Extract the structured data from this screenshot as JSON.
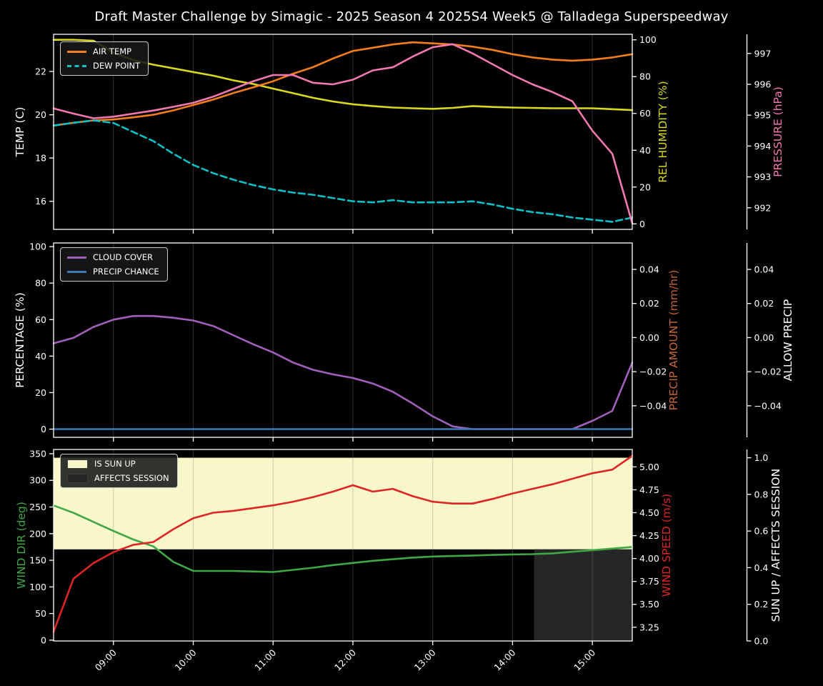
{
  "title": "Draft Master Challenge by Simagic - 2025 Season 4 2025S4 Week5 @ Talladega Superspeedway",
  "style": {
    "background": "#000000",
    "foreground": "#ffffff",
    "grid_color": "rgba(125,125,125,0.38)"
  },
  "xlim": [
    8.25,
    15.5
  ],
  "x_hours": [
    8.25,
    8.5,
    8.75,
    9.0,
    9.25,
    9.5,
    9.75,
    10.0,
    10.25,
    10.5,
    10.75,
    11.0,
    11.25,
    11.5,
    11.75,
    12.0,
    12.25,
    12.5,
    12.75,
    13.0,
    13.25,
    13.5,
    13.75,
    14.0,
    14.25,
    14.5,
    14.75,
    15.0,
    15.25,
    15.5
  ],
  "x_ticks": {
    "hours": [
      9,
      10,
      11,
      12,
      13,
      14,
      15
    ],
    "labels": [
      "09:00",
      "10:00",
      "11:00",
      "12:00",
      "13:00",
      "14:00",
      "15:00"
    ]
  },
  "chart_data": [
    {
      "type": "line",
      "axes": {
        "left": {
          "label": "TEMP (C)",
          "color": "#ffffff",
          "lim": [
            14.7,
            23.72
          ],
          "ticks": [
            16,
            18,
            20,
            22
          ],
          "tick_labels": [
            "16",
            "18",
            "20",
            "22"
          ]
        },
        "right1": {
          "label": "REL HUMIDITY (%)",
          "color": "#d9d91f",
          "lim": [
            -3,
            103
          ],
          "ticks": [
            0,
            20,
            40,
            60,
            80,
            100
          ],
          "tick_labels": [
            "0",
            "20",
            "40",
            "60",
            "80",
            "100"
          ]
        },
        "right2": {
          "label": "PRESSURE (hPa)",
          "color": "#f278b0",
          "lim": [
            991.3,
            997.62
          ],
          "ticks": [
            992,
            993,
            994,
            995,
            996,
            997
          ],
          "tick_labels": [
            "992",
            "993",
            "994",
            "995",
            "996",
            "997"
          ]
        }
      },
      "series": [
        {
          "name": "REL HUMIDITY",
          "axis": "right1",
          "color": "#d9d91f",
          "style": "solid",
          "values": [
            100,
            100,
            99.5,
            93,
            89,
            86.5,
            84.5,
            82.5,
            80.5,
            78,
            76,
            73.5,
            71,
            68.5,
            66.5,
            65,
            64,
            63.2,
            62.8,
            62.5,
            63,
            64,
            63.5,
            63.2,
            63,
            62.8,
            62.8,
            62.8,
            62.3,
            61.8
          ]
        },
        {
          "name": "AIR TEMP",
          "axis": "left",
          "color": "#f57d1c",
          "style": "solid",
          "values": [
            19.5,
            19.63,
            19.74,
            19.78,
            19.88,
            20.0,
            20.2,
            20.45,
            20.7,
            21.0,
            21.27,
            21.55,
            21.9,
            22.2,
            22.6,
            22.95,
            23.1,
            23.25,
            23.35,
            23.3,
            23.25,
            23.15,
            23.0,
            22.8,
            22.65,
            22.55,
            22.5,
            22.55,
            22.65,
            22.8
          ]
        },
        {
          "name": "DEW POINT",
          "axis": "left",
          "color": "#0cc0c6",
          "style": "dashed",
          "values": [
            19.5,
            19.63,
            19.74,
            19.62,
            19.2,
            18.78,
            18.2,
            17.68,
            17.3,
            17.0,
            16.75,
            16.55,
            16.4,
            16.3,
            16.15,
            16.0,
            15.95,
            16.05,
            15.95,
            15.95,
            15.95,
            16.0,
            15.85,
            15.65,
            15.5,
            15.4,
            15.25,
            15.15,
            15.05,
            15.25
          ]
        },
        {
          "name": "PRESSURE",
          "axis": "right2",
          "color": "#f278b0",
          "style": "solid",
          "values": [
            995.22,
            995.05,
            994.9,
            994.95,
            995.05,
            995.15,
            995.27,
            995.4,
            995.6,
            995.85,
            996.1,
            996.3,
            996.3,
            996.05,
            996.0,
            996.15,
            996.45,
            996.55,
            996.9,
            997.2,
            997.3,
            997.0,
            996.65,
            996.3,
            996.0,
            995.75,
            995.45,
            994.5,
            993.75,
            991.5
          ]
        }
      ],
      "legend": [
        {
          "label": "AIR TEMP",
          "color": "#f57d1c",
          "style": "solid"
        },
        {
          "label": "DEW POINT",
          "color": "#0cc0c6",
          "style": "dashed"
        }
      ]
    },
    {
      "type": "line",
      "axes": {
        "left": {
          "label": "PERCENTAGE (%)",
          "color": "#ffffff",
          "lim": [
            -4.5,
            102
          ],
          "ticks": [
            0,
            20,
            40,
            60,
            80,
            100
          ],
          "tick_labels": [
            "0",
            "20",
            "40",
            "60",
            "80",
            "100"
          ]
        },
        "right1": {
          "label": "PRECIP AMOUNT (mm/hr)",
          "color": "#c26636",
          "lim": [
            -0.0585,
            0.0555
          ],
          "ticks": [
            0.04,
            0.02,
            0,
            -0.02,
            -0.04
          ],
          "tick_labels": [
            "0.04",
            "0.02",
            "0.00",
            "−0.02",
            "−0.04"
          ]
        },
        "right2": {
          "label": "ALLOW PRECIP",
          "color": "#ffffff",
          "lim": [
            -0.0585,
            0.0555
          ],
          "ticks": [
            0.04,
            0.02,
            0,
            -0.02,
            -0.04
          ],
          "tick_labels": [
            "0.04",
            "0.02",
            "0.00",
            "−0.02",
            "−0.04"
          ]
        }
      },
      "series": [
        {
          "name": "CLOUD COVER",
          "axis": "left",
          "color": "#a05fb8",
          "style": "solid",
          "values": [
            47,
            50,
            56,
            60,
            62,
            62,
            61,
            59.5,
            56.5,
            51.5,
            46.5,
            42,
            36.5,
            32.5,
            30,
            28,
            25,
            20.5,
            14,
            7,
            1.5,
            0,
            0,
            0,
            0,
            0,
            0,
            4.5,
            10,
            36.5
          ]
        },
        {
          "name": "PRECIP CHANCE",
          "axis": "left",
          "color": "#3d79b8",
          "style": "solid",
          "values": [
            0,
            0,
            0,
            0,
            0,
            0,
            0,
            0,
            0,
            0,
            0,
            0,
            0,
            0,
            0,
            0,
            0,
            0,
            0,
            0,
            0,
            0,
            0,
            0,
            0,
            0,
            0,
            0,
            0,
            0
          ]
        }
      ],
      "legend": [
        {
          "label": "CLOUD COVER",
          "color": "#a05fb8",
          "style": "solid"
        },
        {
          "label": "PRECIP CHANCE",
          "color": "#3d79b8",
          "style": "solid"
        }
      ]
    },
    {
      "type": "line",
      "axes": {
        "left": {
          "label": "WIND DIR (deg)",
          "color": "#3fa745",
          "lim": [
            -1.5,
            358
          ],
          "ticks": [
            0,
            50,
            100,
            150,
            200,
            250,
            300,
            350
          ],
          "tick_labels": [
            "0",
            "50",
            "100",
            "150",
            "200",
            "250",
            "300",
            "350"
          ]
        },
        "right1": {
          "label": "WIND SPEED (m/s)",
          "color": "#dd2525",
          "lim": [
            3.1,
            5.19
          ],
          "ticks": [
            3.25,
            3.5,
            3.75,
            4.0,
            4.25,
            4.5,
            4.75,
            5.0
          ],
          "tick_labels": [
            "3.25",
            "3.50",
            "3.75",
            "4.00",
            "4.25",
            "4.50",
            "4.75",
            "5.00"
          ]
        },
        "right2": {
          "label": "SUN UP / AFFECTS SESSION",
          "color": "#ffffff",
          "lim": [
            0,
            1.045
          ],
          "ticks": [
            0,
            0.2,
            0.4,
            0.6,
            0.8,
            1.0
          ],
          "tick_labels": [
            "0.0",
            "0.2",
            "0.4",
            "0.6",
            "0.8",
            "1.0"
          ]
        }
      },
      "bands": [
        {
          "name": "IS SUN UP",
          "axis": "right2",
          "x0": 8.25,
          "x1": 15.5,
          "y0": 0.5,
          "y1": 1.0,
          "color": "#f7f7c9"
        },
        {
          "name": "AFFECTS SESSION",
          "axis": "right2",
          "x0": 14.27,
          "x1": 15.5,
          "y0": 0.0,
          "y1": 0.5,
          "color": "#262626"
        }
      ],
      "series": [
        {
          "name": "WIND DIR",
          "axis": "left",
          "color": "#3fa745",
          "style": "solid",
          "values": [
            253,
            239,
            222,
            205,
            189,
            176,
            147,
            130,
            130,
            130,
            129,
            128,
            132,
            136,
            141,
            145,
            149,
            152,
            155,
            157,
            158,
            159,
            160,
            161,
            161.5,
            163,
            166,
            169,
            172,
            175
          ]
        },
        {
          "name": "WIND SPEED",
          "axis": "right1",
          "color": "#dd2525",
          "style": "solid",
          "values": [
            3.2,
            3.78,
            3.95,
            4.07,
            4.15,
            4.18,
            4.32,
            4.44,
            4.5,
            4.52,
            4.55,
            4.58,
            4.62,
            4.67,
            4.73,
            4.8,
            4.73,
            4.76,
            4.68,
            4.62,
            4.6,
            4.6,
            4.65,
            4.71,
            4.76,
            4.81,
            4.87,
            4.93,
            4.97,
            5.12
          ]
        }
      ],
      "legend": [
        {
          "label": "IS SUN UP",
          "color": "#f7f7c9",
          "style": "patch"
        },
        {
          "label": "AFFECTS SESSION",
          "color": "#262626",
          "style": "patch"
        }
      ]
    }
  ]
}
